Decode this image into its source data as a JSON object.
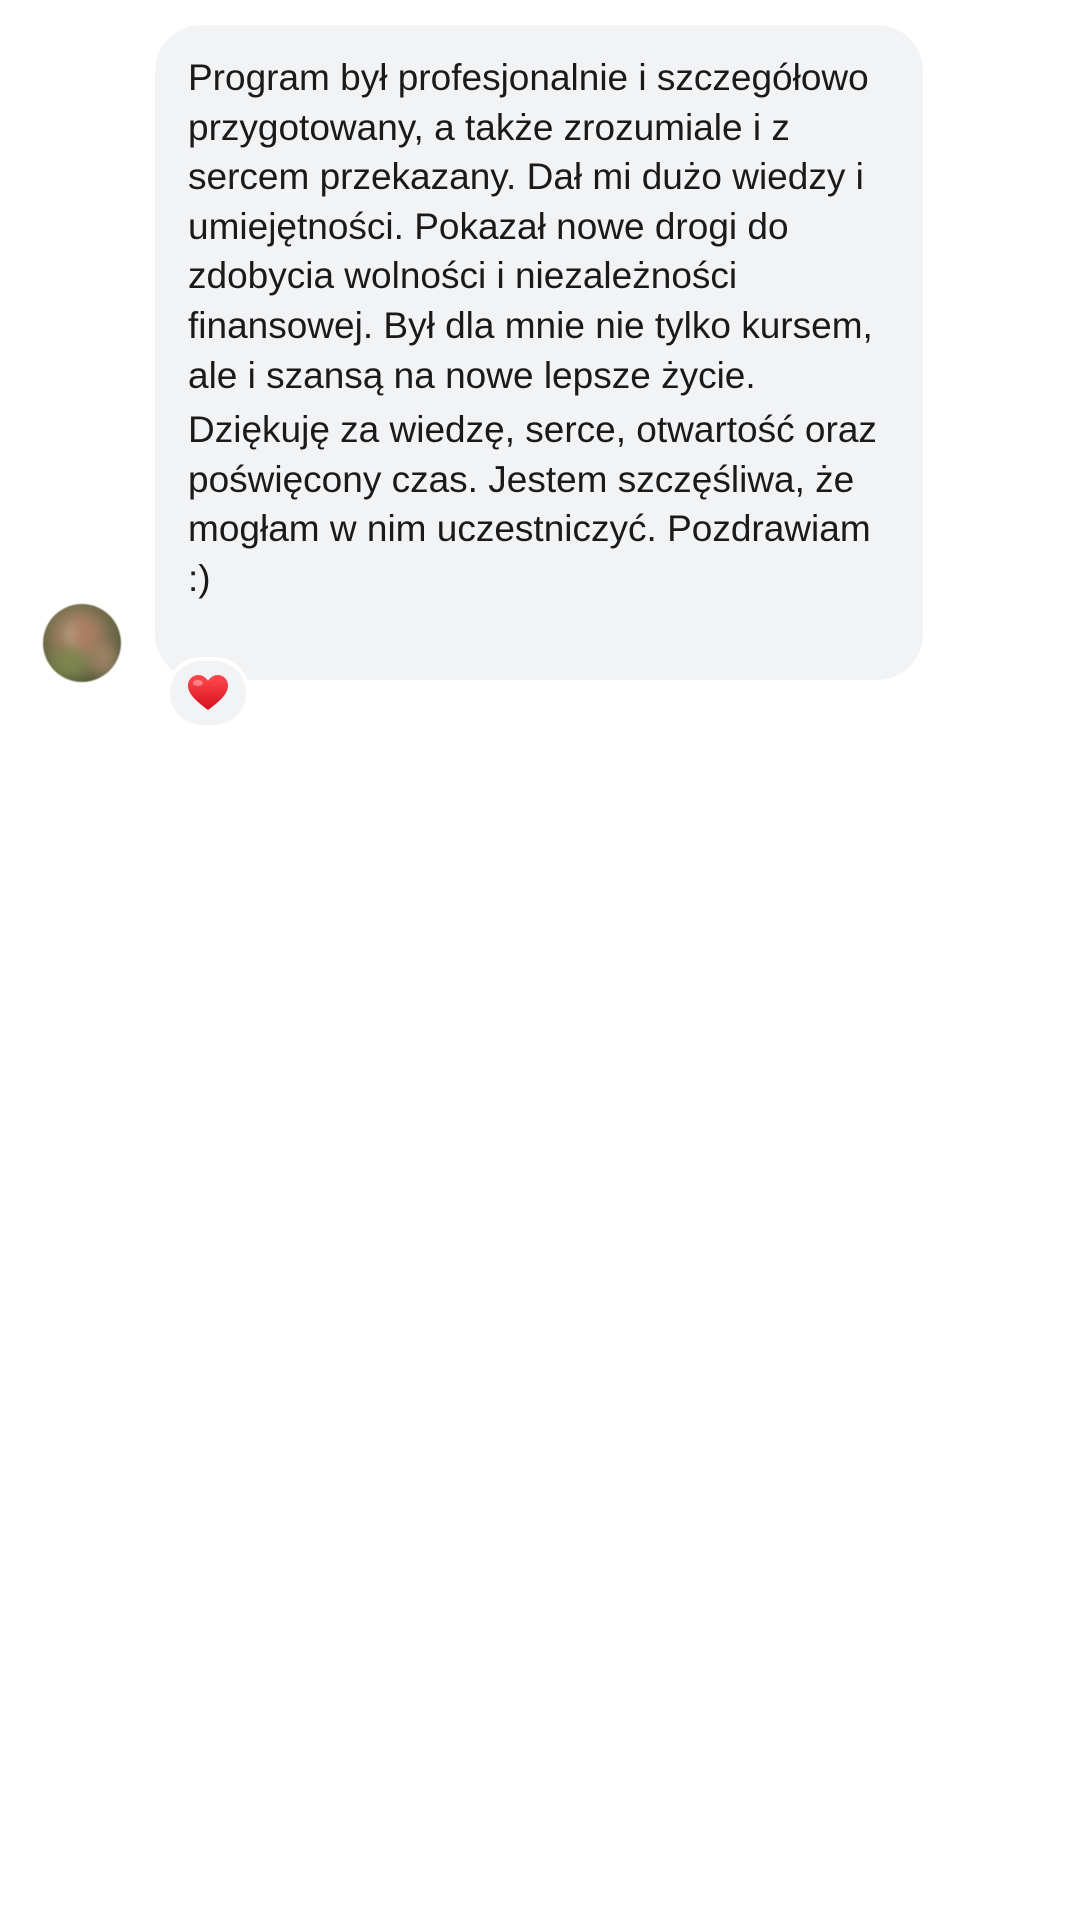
{
  "message": {
    "paragraphs": [
      "Program był profesjonalnie i szczegółowo przygotowany, a także zrozumiale i z sercem przekazany. Dał mi dużo wiedzy i umiejętności. Pokazał nowe drogi do zdobycia wolności i niezależności finansowej. Był dla mnie nie tylko kursem, ale i szansą na nowe lepsze życie.",
      "Dziękuję za wiedzę, serce, otwartość oraz poświęcony czas. Jestem szczęśliwa, że mogłam w nim uczestniczyć. Pozdrawiam :)"
    ],
    "reaction": "heart-icon"
  },
  "colors": {
    "bubble_background": "#f2f3f5",
    "text": "#1a1a1a",
    "reaction_heart": "#e8212e",
    "page_background": "#ffffff"
  }
}
